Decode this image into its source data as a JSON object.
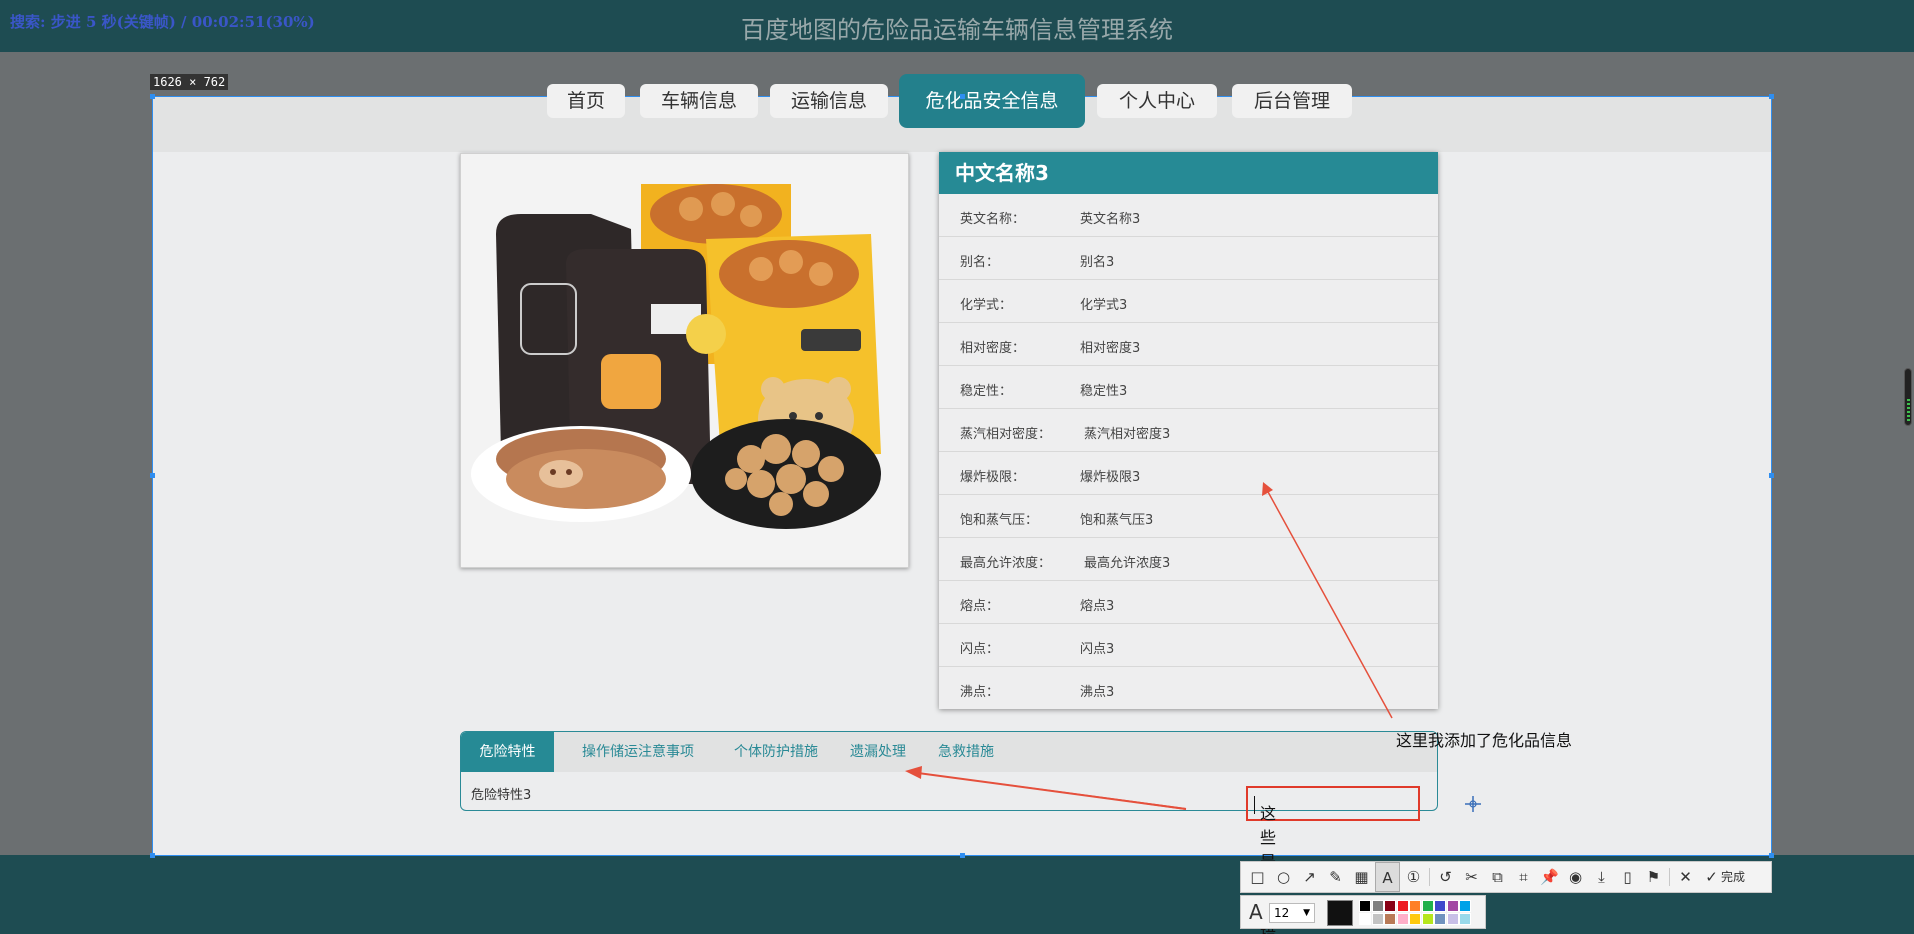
{
  "app_title": "百度地图的危险品运输车辆信息管理系统",
  "player_status": "搜索: 步进 5 秒(关键帧) / 00:02:51(30%)",
  "selection_size": "1626 × 762",
  "nav": [
    {
      "label": "首页",
      "active": false
    },
    {
      "label": "车辆信息",
      "active": false
    },
    {
      "label": "运输信息",
      "active": false
    },
    {
      "label": "危化品安全信息",
      "active": true
    },
    {
      "label": "个人中心",
      "active": false
    },
    {
      "label": "后台管理",
      "active": false
    }
  ],
  "info": {
    "title": "中文名称3",
    "rows": [
      {
        "key": "英文名称：",
        "value": "英文名称3"
      },
      {
        "key": "别名：",
        "value": "别名3"
      },
      {
        "key": "化学式：",
        "value": "化学式3"
      },
      {
        "key": "相对密度：",
        "value": "相对密度3"
      },
      {
        "key": "稳定性：",
        "value": "稳定性3"
      },
      {
        "key": "蒸汽相对密度：",
        "value": "蒸汽相对密度3"
      },
      {
        "key": "爆炸极限：",
        "value": "爆炸极限3"
      },
      {
        "key": "饱和蒸气压：",
        "value": "饱和蒸气压3"
      },
      {
        "key": "最高允许浓度：",
        "value": "最高允许浓度3"
      },
      {
        "key": "熔点：",
        "value": "熔点3"
      },
      {
        "key": "闪点：",
        "value": "闪点3"
      },
      {
        "key": "沸点：",
        "value": "沸点3"
      }
    ]
  },
  "tabs": {
    "items": [
      {
        "label": "危险特性",
        "active": true
      },
      {
        "label": "操作储运注意事项",
        "active": false
      },
      {
        "label": "个体防护措施",
        "active": false
      },
      {
        "label": "遗漏处理",
        "active": false
      },
      {
        "label": "急救措施",
        "active": false
      }
    ],
    "content": "危险特性3"
  },
  "annotations": {
    "note1": "这里我添加了危化品信息",
    "note2": "这些是处理措施"
  },
  "toolbar": {
    "tools": [
      "rectangle-icon",
      "ellipse-icon",
      "arrow-icon",
      "pen-icon",
      "mosaic-icon",
      "text-icon",
      "number-icon",
      "undo-icon",
      "cut-icon",
      "ocr-icon",
      "scan-icon",
      "pin-icon",
      "record-icon",
      "save-icon",
      "long-screenshot-icon",
      "bookmark-icon",
      "close-icon"
    ],
    "done_label": "完成",
    "font_size": "12",
    "current_color": "#111111",
    "palette": [
      "#000000",
      "#7f7f7f",
      "#880015",
      "#ed1c24",
      "#ff7f27",
      "#22b14c",
      "#3f48cc",
      "#a349a4",
      "#00a2e8",
      "#ffffff",
      "#c3c3c3",
      "#b97a57",
      "#ffaec9",
      "#ffc90e",
      "#b5e61d",
      "#7092be",
      "#c8bfe7",
      "#99d9ea"
    ]
  }
}
